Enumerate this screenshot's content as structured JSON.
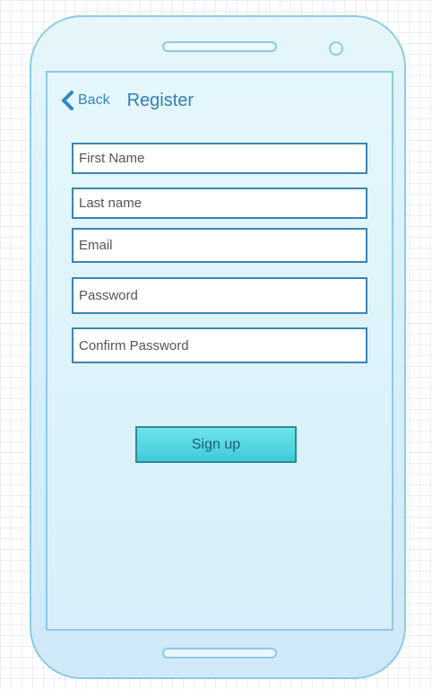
{
  "nav": {
    "back_label": "Back",
    "title": "Register"
  },
  "form": {
    "first_name_placeholder": "First Name",
    "last_name_placeholder": "Last name",
    "email_placeholder": "Email",
    "password_placeholder": "Password",
    "confirm_password_placeholder": "Confirm Password",
    "signup_label": "Sign up"
  },
  "icons": {
    "back": "chevron-left-icon"
  },
  "colors": {
    "accent": "#2f86c6",
    "button": "#4fd4e0",
    "field_border": "#3a86b0",
    "device_outline": "#8ecae6"
  }
}
